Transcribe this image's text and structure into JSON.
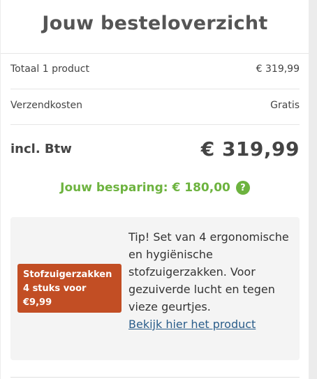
{
  "title": "Jouw besteloverzicht",
  "summary": {
    "products_label": "Totaal 1 product",
    "products_value": "€ 319,99",
    "shipping_label": "Verzendkosten",
    "shipping_value": "Gratis",
    "total_label": "incl. Btw",
    "total_value": "€ 319,99"
  },
  "savings": {
    "text": "Jouw besparing: € 180,00",
    "help_icon": "?"
  },
  "tip": {
    "badge": "Stofzuigerzakken 4 stuks voor €9,99",
    "text": "Tip! Set van 4 ergonomische en hygiënische stofzuigerzakken. Voor gezuiverde lucht en tegen vieze geurtjes.",
    "link": "Bekijk hier het product"
  },
  "colors": {
    "savings": "#6db33f",
    "badge": "#c24e24",
    "link": "#2a5d8a"
  }
}
